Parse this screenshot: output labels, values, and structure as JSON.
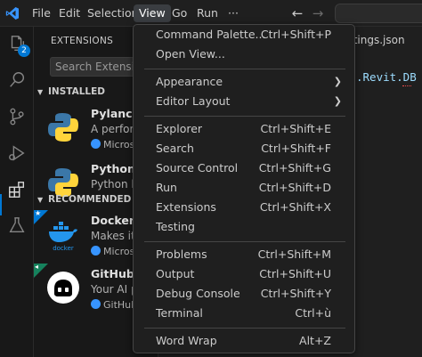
{
  "titlebar": {
    "menus": [
      "File",
      "Edit",
      "Selection",
      "View",
      "Go",
      "Run",
      "···"
    ],
    "active_menu": "View"
  },
  "activitybar": {
    "icons": [
      "explorer-icon",
      "search-icon",
      "source-control-icon",
      "run-debug-icon",
      "extensions-icon",
      "flask-icon"
    ],
    "explorer_badge": "2",
    "accent_color": "#0078d4"
  },
  "sidebar": {
    "title": "EXTENSIONS",
    "search_placeholder": "Search Extensions",
    "installed_header": "INSTALLED",
    "recommended_header": "RECOMMENDED",
    "installed": [
      {
        "name": "Pylance",
        "desc": "A perform",
        "publisher": "Microso"
      },
      {
        "name": "Python",
        "desc": "Python lar",
        "publisher": ""
      }
    ],
    "recommended": [
      {
        "name": "Docker",
        "desc": "Makes it e",
        "publisher": "Microso"
      },
      {
        "name": "GitHub C",
        "desc": "Your AI pa",
        "publisher": "GitHub"
      }
    ]
  },
  "editor": {
    "tab_fragment": "ttings.json",
    "code_fragment": ".Revit.DB"
  },
  "view_menu": {
    "groups": [
      [
        {
          "label": "Command Palette...",
          "shortcut": "Ctrl+Shift+P"
        },
        {
          "label": "Open View...",
          "shortcut": ""
        }
      ],
      [
        {
          "label": "Appearance",
          "shortcut": "",
          "submenu": true
        },
        {
          "label": "Editor Layout",
          "shortcut": "",
          "submenu": true
        }
      ],
      [
        {
          "label": "Explorer",
          "shortcut": "Ctrl+Shift+E"
        },
        {
          "label": "Search",
          "shortcut": "Ctrl+Shift+F"
        },
        {
          "label": "Source Control",
          "shortcut": "Ctrl+Shift+G"
        },
        {
          "label": "Run",
          "shortcut": "Ctrl+Shift+D"
        },
        {
          "label": "Extensions",
          "shortcut": "Ctrl+Shift+X"
        },
        {
          "label": "Testing",
          "shortcut": ""
        }
      ],
      [
        {
          "label": "Problems",
          "shortcut": "Ctrl+Shift+M"
        },
        {
          "label": "Output",
          "shortcut": "Ctrl+Shift+U"
        },
        {
          "label": "Debug Console",
          "shortcut": "Ctrl+Shift+Y"
        },
        {
          "label": "Terminal",
          "shortcut": "Ctrl+ù"
        }
      ],
      [
        {
          "label": "Word Wrap",
          "shortcut": "Alt+Z"
        }
      ]
    ]
  }
}
